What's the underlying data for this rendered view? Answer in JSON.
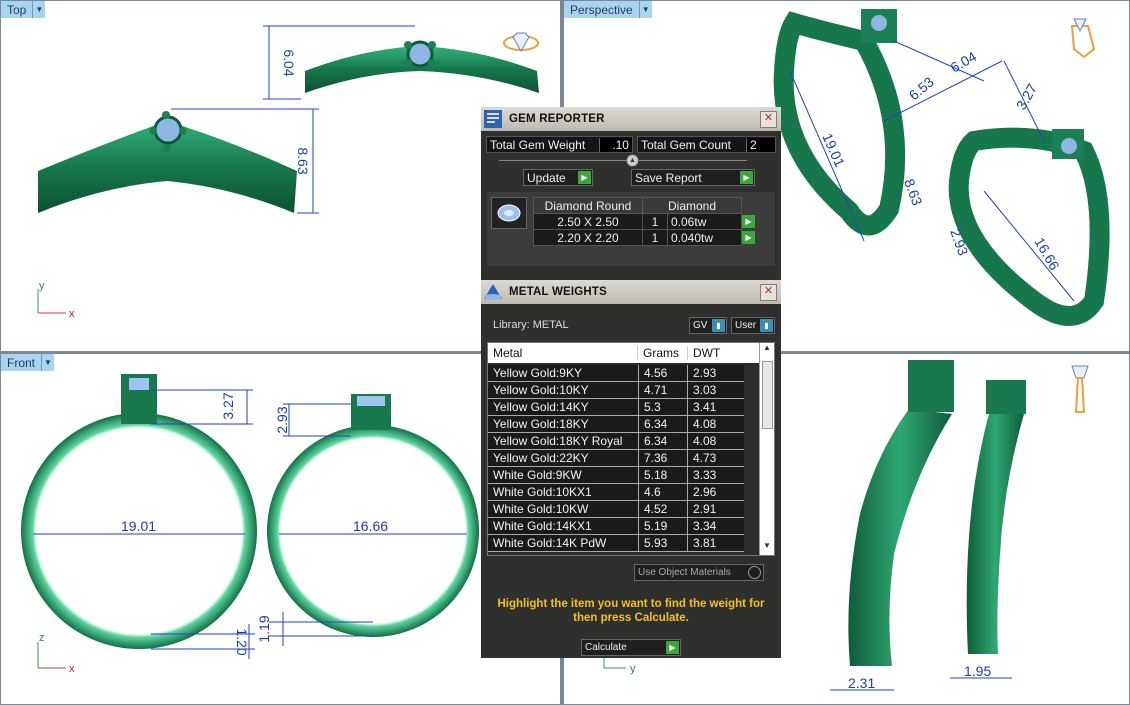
{
  "viewports": {
    "top": {
      "label": "Top",
      "axes": [
        "y",
        "x"
      ],
      "dims": [
        "6.04",
        "8.63"
      ]
    },
    "perspective": {
      "label": "Perspective",
      "dims": [
        "19.01",
        "6.53",
        "6.04",
        "3.27",
        "8.63",
        "16.66",
        "2.93"
      ]
    },
    "front": {
      "label": "Front",
      "axes": [
        "z",
        "x"
      ],
      "dims": [
        "19.01",
        "16.66",
        "3.27",
        "2.93",
        "1.20",
        "1.19"
      ]
    },
    "right": {
      "axes": [
        "y"
      ],
      "dims": [
        "2.31",
        "1.95"
      ]
    }
  },
  "gem_reporter": {
    "title": "GEM REPORTER",
    "total_weight_label": "Total Gem Weight",
    "total_weight_value": ".10",
    "total_count_label": "Total Gem Count",
    "total_count_value": "2",
    "update_label": "Update",
    "save_report_label": "Save Report",
    "headers": [
      "Diamond Round",
      "Diamond"
    ],
    "rows": [
      {
        "size": "2.50 X 2.50",
        "count": "1",
        "weight": "0.06tw"
      },
      {
        "size": "2.20 X 2.20",
        "count": "1",
        "weight": "0.040tw"
      }
    ]
  },
  "metal_weights": {
    "title": "METAL WEIGHTS",
    "library_label": "Library: METAL",
    "gv_label": "GV",
    "user_label": "User",
    "columns": [
      "Metal",
      "Grams",
      "DWT"
    ],
    "rows": [
      {
        "metal": "Yellow Gold:9KY",
        "grams": "4.56",
        "dwt": "2.93"
      },
      {
        "metal": "Yellow Gold:10KY",
        "grams": "4.71",
        "dwt": "3.03"
      },
      {
        "metal": "Yellow Gold:14KY",
        "grams": "5.3",
        "dwt": "3.41"
      },
      {
        "metal": "Yellow Gold:18KY",
        "grams": "6.34",
        "dwt": "4.08"
      },
      {
        "metal": "Yellow Gold:18KY Royal",
        "grams": "6.34",
        "dwt": "4.08"
      },
      {
        "metal": "Yellow Gold:22KY",
        "grams": "7.36",
        "dwt": "4.73"
      },
      {
        "metal": "White Gold:9KW",
        "grams": "5.18",
        "dwt": "3.33"
      },
      {
        "metal": "White Gold:10KX1",
        "grams": "4.6",
        "dwt": "2.96"
      },
      {
        "metal": "White Gold:10KW",
        "grams": "4.52",
        "dwt": "2.91"
      },
      {
        "metal": "White Gold:14KX1",
        "grams": "5.19",
        "dwt": "3.34"
      },
      {
        "metal": "White Gold:14K PdW",
        "grams": "5.93",
        "dwt": "3.81"
      }
    ],
    "use_object_materials_label": "Use Object Materials",
    "hint": "Highlight the item you want to find the weight for then press Calculate.",
    "calculate_label": "Calculate"
  },
  "colors": {
    "ring_green": "#1e8a5c",
    "dim_blue": "#1a3fa8",
    "hint_yellow": "#f4c21b",
    "tab_blue": "#a9d4ef"
  }
}
